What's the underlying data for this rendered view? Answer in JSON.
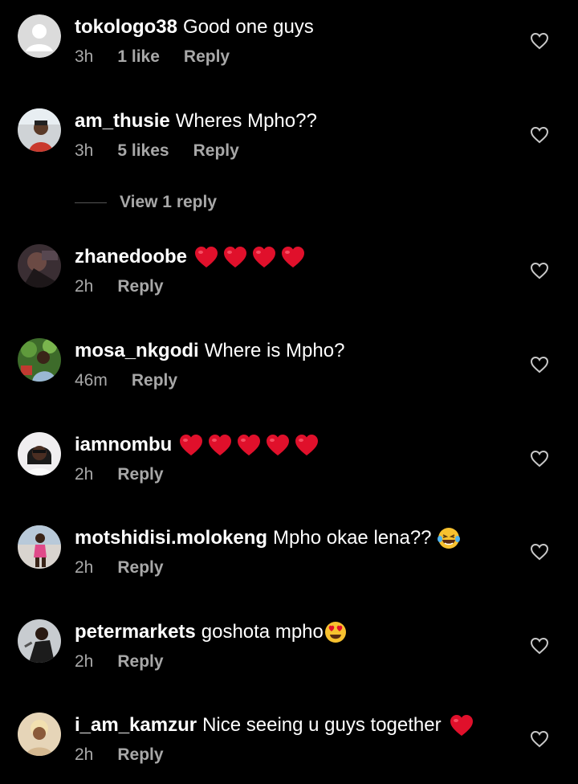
{
  "comments": [
    {
      "username": "tokologo38",
      "text": "Good one guys",
      "time": "3h",
      "likes": "1 like",
      "reply": "Reply",
      "avatar": "default"
    },
    {
      "username": "am_thusie",
      "text": "Wheres Mpho??",
      "time": "3h",
      "likes": "5 likes",
      "reply": "Reply",
      "avatar": "photo"
    },
    {
      "username": "zhanedoobe",
      "text": "",
      "hearts": 4,
      "time": "2h",
      "likes": "",
      "reply": "Reply",
      "avatar": "photo"
    },
    {
      "username": "mosa_nkgodi",
      "text": "Where is Mpho?",
      "time": "46m",
      "likes": "",
      "reply": "Reply",
      "avatar": "photo"
    },
    {
      "username": "iamnombu",
      "text": "",
      "hearts": 5,
      "time": "2h",
      "likes": "",
      "reply": "Reply",
      "avatar": "photo"
    },
    {
      "username": "motshidisi.molokeng",
      "text": "Mpho okae lena??",
      "emoji": "laughing-tears",
      "time": "2h",
      "likes": "",
      "reply": "Reply",
      "avatar": "photo"
    },
    {
      "username": "petermarkets",
      "text": "goshota mpho",
      "emoji": "heart-eyes",
      "time": "2h",
      "likes": "",
      "reply": "Reply",
      "avatar": "photo"
    },
    {
      "username": "i_am_kamzur",
      "text": "Nice seeing u guys together",
      "hearts": 1,
      "time": "2h",
      "likes": "",
      "reply": "Reply",
      "avatar": "photo"
    }
  ],
  "view_replies": "View 1 reply",
  "colors": {
    "background": "#000000",
    "secondary_text": "#a8a8a8",
    "heart": "#e0102b"
  }
}
